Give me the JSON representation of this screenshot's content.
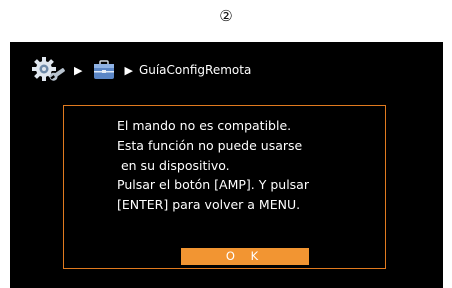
{
  "step_marker": "②",
  "header": {
    "breadcrumb_label": "GuíaConfigRemota",
    "icons": [
      "setup-gear-icon",
      "briefcase-icon",
      "arrow-right-icon"
    ]
  },
  "dialog": {
    "lines": [
      "El mando no es compatible.",
      "Esta función no puede usarse",
      " en su dispositivo.",
      "Pulsar el botón [AMP]. Y pulsar",
      "[ENTER] para volver a MENU."
    ],
    "ok_label": "O K"
  },
  "colors": {
    "screen_bg": "#000000",
    "border_accent": "#e07a1f",
    "button_accent": "#f29532",
    "text": "#ffffff"
  }
}
